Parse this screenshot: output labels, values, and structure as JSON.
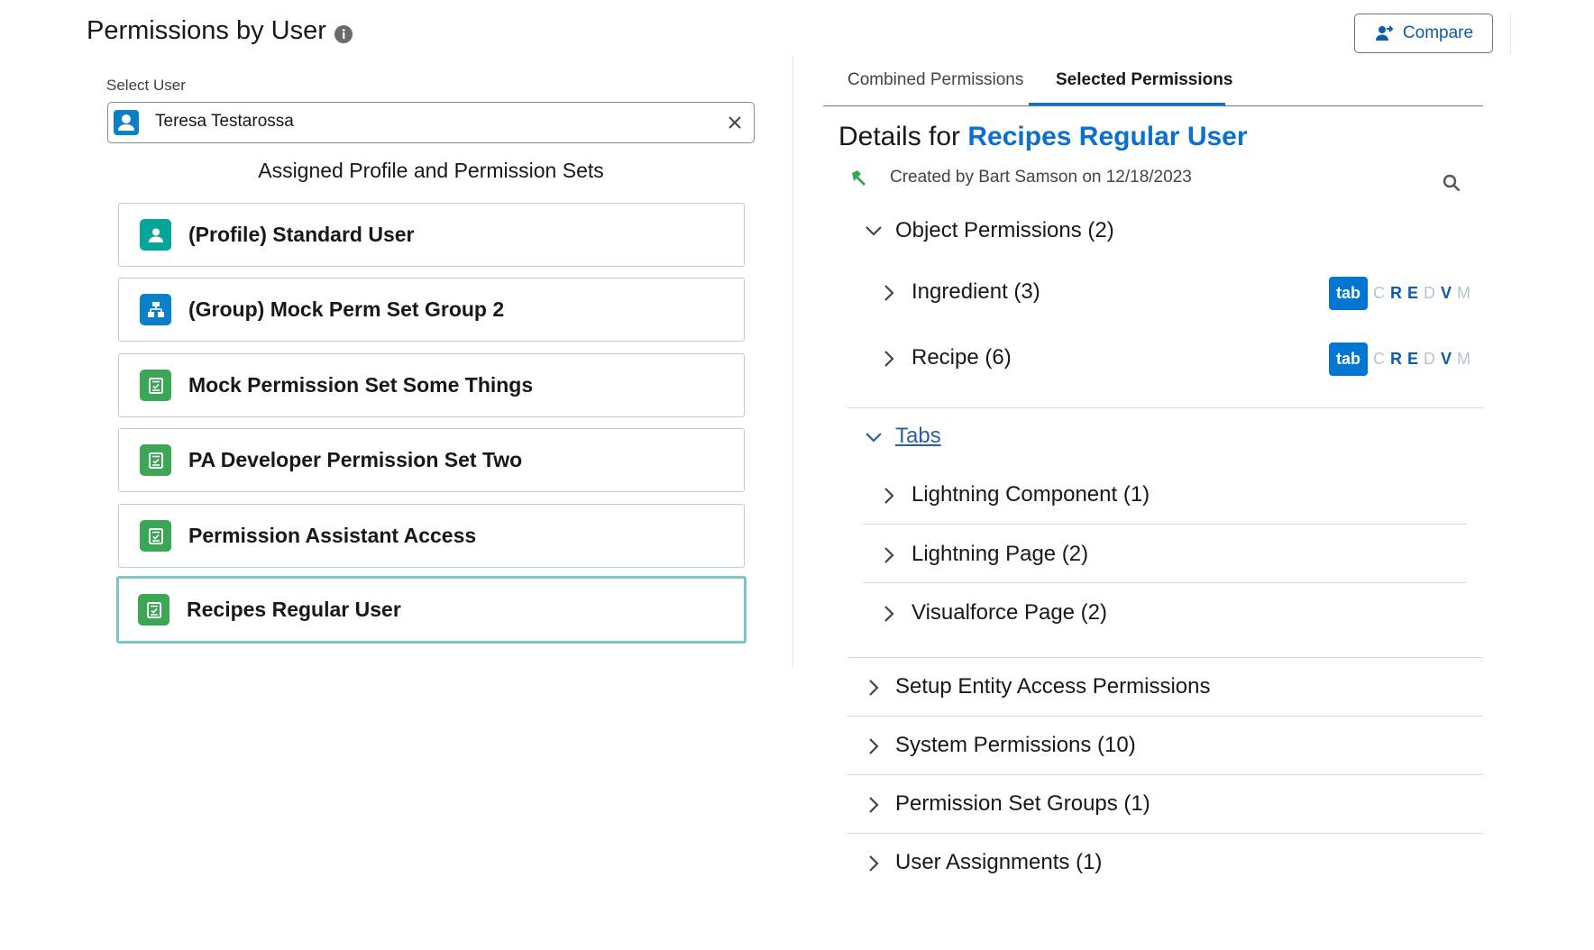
{
  "header": {
    "title": "Permissions by User",
    "compare_label": "Compare"
  },
  "left": {
    "select_user_label": "Select User",
    "selected_user": "Teresa Testarossa",
    "assigned_heading": "Assigned Profile and Permission Sets",
    "items": [
      {
        "label": "(Profile) Standard User",
        "icon": "user-icon",
        "color": "#06a59a"
      },
      {
        "label": "(Group) Mock Perm Set Group 2",
        "icon": "permission-set-group-icon",
        "color": "#0b7fc8"
      },
      {
        "label": "Mock Permission Set Some Things",
        "icon": "permission-set-icon",
        "color": "#3ba755"
      },
      {
        "label": "PA Developer Permission Set Two",
        "icon": "permission-set-icon",
        "color": "#3ba755"
      },
      {
        "label": "Permission Assistant Access",
        "icon": "permission-set-icon",
        "color": "#3ba755"
      },
      {
        "label": "Recipes Regular User",
        "icon": "permission-set-icon",
        "color": "#3ba755",
        "selected": true
      }
    ]
  },
  "right": {
    "tabs": [
      "Combined Permissions",
      "Selected Permissions"
    ],
    "active_tab": "Selected Permissions",
    "details_prefix": "Details for",
    "details_name": "Recipes Regular User",
    "created_text": "Created by Bart Samson on 12/18/2023",
    "object_permissions": {
      "label": "Object Permissions (2)",
      "items": [
        {
          "label": "Ingredient (3)",
          "badge": "tab",
          "flags": {
            "C": false,
            "R": true,
            "E": true,
            "D": false,
            "V": true,
            "M": false
          }
        },
        {
          "label": "Recipe (6)",
          "badge": "tab",
          "flags": {
            "C": false,
            "R": true,
            "E": true,
            "D": false,
            "V": true,
            "M": false
          }
        }
      ]
    },
    "tabs_section": {
      "label": "Tabs",
      "items": [
        "Lightning Component (1)",
        "Lightning Page (2)",
        "Visualforce Page (2)"
      ]
    },
    "other_sections": [
      "Setup Entity Access Permissions",
      "System Permissions (10)",
      "Permission Set Groups (1)",
      "User Assignments (1)"
    ]
  }
}
